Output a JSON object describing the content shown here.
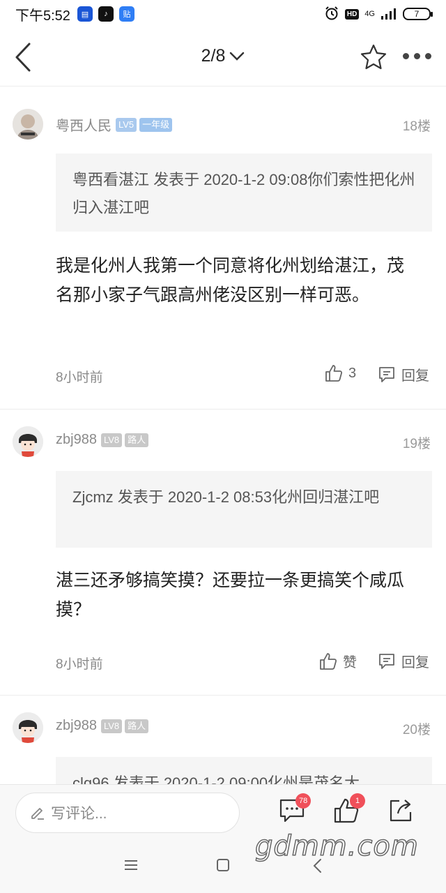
{
  "status_bar": {
    "time": "下午5:52",
    "hd": "HD",
    "network": "4G",
    "battery": "7"
  },
  "nav": {
    "page_indicator": "2/8"
  },
  "posts": [
    {
      "username": "粤西人民",
      "level": "LV5",
      "title_badge": "一年级",
      "floor": "18楼",
      "quote": "粤西看湛江 发表于 2020-1-2 09:08你们索性把化州归入湛江吧",
      "content": "我是化州人我第一个同意将化州划给湛江，茂名那小家子气跟高州佬没区别一样可恶。",
      "time": "8小时前",
      "like_label": "3",
      "reply_label": "回复"
    },
    {
      "username": "zbj988",
      "level": "LV8",
      "title_badge": "路人",
      "floor": "19楼",
      "quote": "Zjcmz 发表于 2020-1-2 08:53化州回归湛江吧",
      "content": "湛三还矛够搞笑摸？还要拉一条更搞笑个咸瓜摸？",
      "time": "8小时前",
      "like_label": "赞",
      "reply_label": "回复"
    },
    {
      "username": "zbj988",
      "level": "LV8",
      "title_badge": "路人",
      "floor": "20楼",
      "quote": "clq96 发表于 2020-1-2 09:00化州是茂名大"
    }
  ],
  "bottom_bar": {
    "comment_placeholder": "写评论...",
    "comments_count": "78",
    "likes_count": "1"
  },
  "watermark": "gdmm.com",
  "colors": {
    "level_badge_lv5": "#a9c9ee",
    "title_badge_blue": "#9ec4ee",
    "level_badge_gray": "#c8c8c8",
    "notification_red": "#f0505a"
  }
}
